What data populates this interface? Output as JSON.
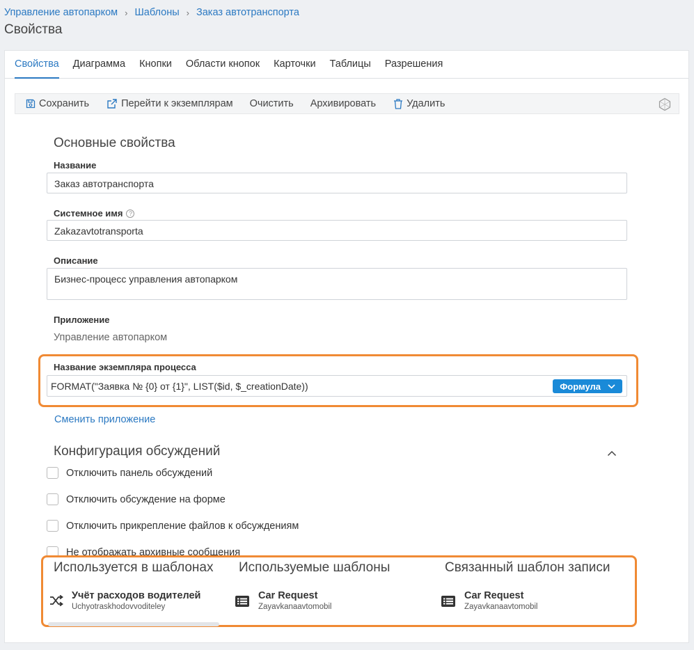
{
  "breadcrumb": {
    "items": [
      "Управление автопарком",
      "Шаблоны",
      "Заказ автотранспорта"
    ]
  },
  "page": {
    "title": "Свойства"
  },
  "tabs": [
    {
      "label": "Свойства",
      "active": true
    },
    {
      "label": "Диаграмма",
      "active": false
    },
    {
      "label": "Кнопки",
      "active": false
    },
    {
      "label": "Области кнопок",
      "active": false
    },
    {
      "label": "Карточки",
      "active": false
    },
    {
      "label": "Таблицы",
      "active": false
    },
    {
      "label": "Разрешения",
      "active": false
    }
  ],
  "toolbar": {
    "save": "Сохранить",
    "goto_instances": "Перейти к экземплярам",
    "clear": "Очистить",
    "archive": "Архивировать",
    "delete": "Удалить"
  },
  "basic": {
    "title": "Основные свойства",
    "name_label": "Название",
    "name_value": "Заказ автотранспорта",
    "sysname_label": "Системное имя",
    "sysname_value": "Zakazavtotransporta",
    "description_label": "Описание",
    "description_value": "Бизнес-процесс управления автопарком",
    "app_label": "Приложение",
    "app_value": "Управление автопарком",
    "instance_label": "Название экземпляра процесса",
    "instance_value": "FORMAT(\"Заявка № {0} от {1}\", LIST($id, $_creationDate))",
    "formula_button": "Формула",
    "change_app_link": "Сменить приложение"
  },
  "discussions": {
    "title": "Конфигурация обсуждений",
    "options": [
      "Отключить панель обсуждений",
      "Отключить обсуждение на форме",
      "Отключить прикрепление файлов к обсуждениям",
      "Не отображать архивные сообщения"
    ]
  },
  "templates": {
    "used_in": {
      "title": "Используется в шаблонах",
      "name": "Учёт расходов водителей",
      "sysname": "Uchyotraskhodovvoditeley"
    },
    "used": {
      "title": "Используемые шаблоны",
      "name": "Car Request",
      "sysname": "Zayavkanaavtomobil"
    },
    "linked": {
      "title": "Связанный шаблон записи",
      "name": "Car Request",
      "sysname": "Zayavkanaavtomobil"
    }
  },
  "colors": {
    "accent": "#2b79c2",
    "highlight": "#f08a34",
    "formula": "#1a8ad8"
  }
}
